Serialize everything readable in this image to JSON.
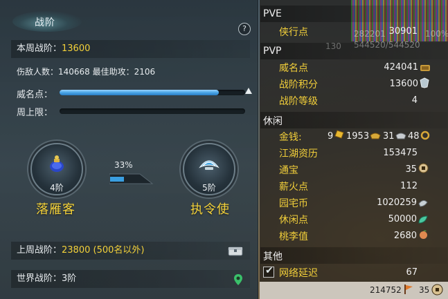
{
  "panel": {
    "title": "战阶",
    "help_label": "?"
  },
  "weekly": {
    "label": "本周战阶：",
    "value": "13600"
  },
  "kills": {
    "line": "伤敌人数：140668   最佳助攻：2106"
  },
  "prestige_bar": {
    "label": "威名点：",
    "fill_fraction": 0.86
  },
  "week_cap_bar": {
    "label": "周上限：",
    "fill_fraction": 0.0
  },
  "current_rank": {
    "level": "4阶",
    "name": "落雁客"
  },
  "next_rank": {
    "level": "5阶",
    "name": "执令使"
  },
  "progress": {
    "percent_text": "33%",
    "fraction": 0.33
  },
  "last_week": {
    "label": "上周战阶：",
    "value": "23800 (500名以外)"
  },
  "world": {
    "label": "世界战阶：3阶"
  },
  "right": {
    "strip_numbers_1": "282201",
    "strip_numbers_2": "544520/544520",
    "strip_percent": "100%",
    "strip_small": "130",
    "pve_header": "PVE",
    "pve": [
      {
        "label": "侠行点",
        "value": "30901"
      }
    ],
    "pvp_header": "PVP",
    "pvp": [
      {
        "label": "威名点",
        "value": "424041"
      },
      {
        "label": "战阶积分",
        "value": "13600"
      },
      {
        "label": "战阶等级",
        "value": "4"
      }
    ],
    "leisure_header": "休闲",
    "money": {
      "label": "金钱:",
      "gold": "9",
      "silver": "1953",
      "copper1": "31",
      "copper2": "48"
    },
    "leisure": [
      {
        "label": "江湖资历",
        "value": "153475"
      },
      {
        "label": "通宝",
        "value": "35"
      },
      {
        "label": "薪火点",
        "value": "112"
      },
      {
        "label": "园宅币",
        "value": "1020259"
      },
      {
        "label": "休闲点",
        "value": "50000"
      },
      {
        "label": "桃李值",
        "value": "2680"
      }
    ],
    "other_header": "其他",
    "latency": {
      "label": "网络延迟",
      "value": "67"
    },
    "footer": {
      "left": "214752",
      "right": "35"
    }
  }
}
